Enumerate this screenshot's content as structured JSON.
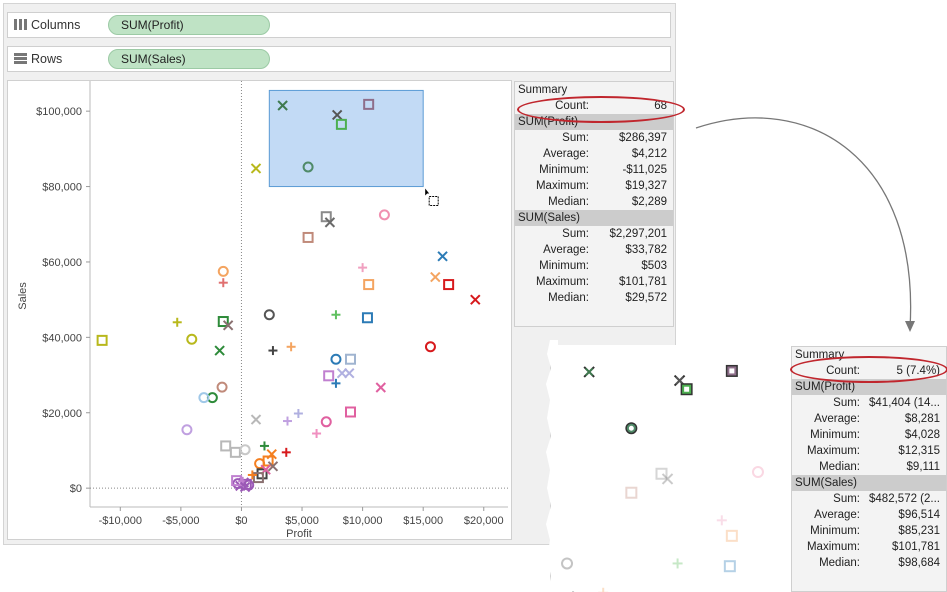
{
  "shelves": {
    "columns": {
      "label": "Columns",
      "pill": "SUM(Profit)"
    },
    "rows": {
      "label": "Rows",
      "pill": "SUM(Sales)"
    }
  },
  "chart_data": {
    "type": "scatter",
    "xlabel": "Profit",
    "ylabel": "Sales",
    "xlim": [
      -12500,
      22000
    ],
    "ylim": [
      -5000,
      108000
    ],
    "x_ticks": [
      -10000,
      -5000,
      0,
      5000,
      10000,
      15000,
      20000
    ],
    "x_tick_labels": [
      "-$10,000",
      "-$5,000",
      "$0",
      "$5,000",
      "$10,000",
      "$15,000",
      "$20,000"
    ],
    "y_ticks": [
      0,
      20000,
      40000,
      60000,
      80000,
      100000
    ],
    "y_tick_labels": [
      "$0",
      "$20,000",
      "$40,000",
      "$60,000",
      "$80,000",
      "$100,000"
    ],
    "grid": false,
    "selection": {
      "x_range": [
        2300,
        15000
      ],
      "y_range": [
        80000,
        105500
      ]
    },
    "points": [
      {
        "x": 3400,
        "y": 101500,
        "shape": "x",
        "color": "#3f7a4f"
      },
      {
        "x": 7900,
        "y": 99000,
        "shape": "x",
        "color": "#555555"
      },
      {
        "x": 8250,
        "y": 96500,
        "shape": "square",
        "color": "#4caf50"
      },
      {
        "x": 10500,
        "y": 101800,
        "shape": "square",
        "color": "#8e6e8a"
      },
      {
        "x": 5500,
        "y": 85200,
        "shape": "circle",
        "color": "#4f8a68"
      },
      {
        "x": 1200,
        "y": 84800,
        "shape": "x",
        "color": "#b8b81c"
      },
      {
        "x": 7000,
        "y": 72000,
        "shape": "square",
        "color": "#8a8a8a"
      },
      {
        "x": 7300,
        "y": 70500,
        "shape": "x",
        "color": "#6b6b6b"
      },
      {
        "x": 11800,
        "y": 72500,
        "shape": "circle",
        "color": "#f090b0"
      },
      {
        "x": 5500,
        "y": 66500,
        "shape": "square",
        "color": "#c08a7a"
      },
      {
        "x": 16600,
        "y": 61500,
        "shape": "x",
        "color": "#2c7bb6"
      },
      {
        "x": 10000,
        "y": 58500,
        "shape": "plus",
        "color": "#f0a0c0"
      },
      {
        "x": 16000,
        "y": 56000,
        "shape": "x",
        "color": "#f4a460"
      },
      {
        "x": 10500,
        "y": 54000,
        "shape": "square",
        "color": "#f4a460"
      },
      {
        "x": 17100,
        "y": 54000,
        "shape": "square",
        "color": "#d7191c"
      },
      {
        "x": 19300,
        "y": 50000,
        "shape": "x",
        "color": "#d7191c"
      },
      {
        "x": -1500,
        "y": 57500,
        "shape": "circle",
        "color": "#f4a460"
      },
      {
        "x": -1500,
        "y": 54500,
        "shape": "plus",
        "color": "#e07070"
      },
      {
        "x": 2300,
        "y": 46000,
        "shape": "circle",
        "color": "#555555"
      },
      {
        "x": 7800,
        "y": 46000,
        "shape": "plus",
        "color": "#60c060"
      },
      {
        "x": 10400,
        "y": 45200,
        "shape": "square",
        "color": "#2c7bb6"
      },
      {
        "x": -1500,
        "y": 44200,
        "shape": "square",
        "color": "#2e8b3a"
      },
      {
        "x": -1100,
        "y": 43200,
        "shape": "x",
        "color": "#8a7070"
      },
      {
        "x": -5300,
        "y": 44000,
        "shape": "plus",
        "color": "#b8b81c"
      },
      {
        "x": -11500,
        "y": 39200,
        "shape": "square",
        "color": "#b8b81c"
      },
      {
        "x": -4100,
        "y": 39500,
        "shape": "circle",
        "color": "#b8b81c"
      },
      {
        "x": -1800,
        "y": 36500,
        "shape": "x",
        "color": "#2e8b3a"
      },
      {
        "x": 2600,
        "y": 36500,
        "shape": "plus",
        "color": "#444444"
      },
      {
        "x": 4100,
        "y": 37500,
        "shape": "plus",
        "color": "#f4a460"
      },
      {
        "x": 15600,
        "y": 37500,
        "shape": "circle",
        "color": "#d7191c"
      },
      {
        "x": 7800,
        "y": 34200,
        "shape": "circle",
        "color": "#2c7bb6"
      },
      {
        "x": 9000,
        "y": 34200,
        "shape": "square",
        "color": "#a0b4d0"
      },
      {
        "x": 7800,
        "y": 27800,
        "shape": "plus",
        "color": "#2c7bb6"
      },
      {
        "x": 7200,
        "y": 29800,
        "shape": "square",
        "color": "#c080d0"
      },
      {
        "x": 8300,
        "y": 30500,
        "shape": "x",
        "color": "#b0b0e0"
      },
      {
        "x": 8900,
        "y": 30500,
        "shape": "x",
        "color": "#b0b0e0"
      },
      {
        "x": 11500,
        "y": 26700,
        "shape": "x",
        "color": "#e060a0"
      },
      {
        "x": -1600,
        "y": 26800,
        "shape": "circle",
        "color": "#c08a7a"
      },
      {
        "x": -2400,
        "y": 24000,
        "shape": "circle",
        "color": "#2e8b3a"
      },
      {
        "x": -3100,
        "y": 24000,
        "shape": "circle",
        "color": "#a0c8e8"
      },
      {
        "x": 4700,
        "y": 19800,
        "shape": "plus",
        "color": "#b0b0e0"
      },
      {
        "x": 3800,
        "y": 17800,
        "shape": "plus",
        "color": "#c0a0e0"
      },
      {
        "x": 9000,
        "y": 20200,
        "shape": "square",
        "color": "#e060a0"
      },
      {
        "x": 7000,
        "y": 17600,
        "shape": "circle",
        "color": "#e060a0"
      },
      {
        "x": 6200,
        "y": 14500,
        "shape": "plus",
        "color": "#f090c0"
      },
      {
        "x": 1200,
        "y": 18200,
        "shape": "x",
        "color": "#b8b8b8"
      },
      {
        "x": -4500,
        "y": 15500,
        "shape": "circle",
        "color": "#c0a0e0"
      },
      {
        "x": -1300,
        "y": 11200,
        "shape": "square",
        "color": "#b8b8b8"
      },
      {
        "x": -500,
        "y": 9500,
        "shape": "square",
        "color": "#b8b8b8"
      },
      {
        "x": 300,
        "y": 10200,
        "shape": "circle",
        "color": "#c8c8c8"
      },
      {
        "x": 1900,
        "y": 11200,
        "shape": "plus",
        "color": "#2e8b3a"
      },
      {
        "x": 3700,
        "y": 9500,
        "shape": "plus",
        "color": "#d7191c"
      },
      {
        "x": 2500,
        "y": 9000,
        "shape": "x",
        "color": "#f47f20"
      },
      {
        "x": 2200,
        "y": 7200,
        "shape": "square",
        "color": "#f47f20"
      },
      {
        "x": 1500,
        "y": 6500,
        "shape": "circle",
        "color": "#f47f20"
      },
      {
        "x": 2600,
        "y": 5800,
        "shape": "x",
        "color": "#8a7070"
      },
      {
        "x": 1700,
        "y": 3800,
        "shape": "square",
        "color": "#444444"
      },
      {
        "x": 2000,
        "y": 4900,
        "shape": "x",
        "color": "#e060a0"
      },
      {
        "x": 1400,
        "y": 2800,
        "shape": "square",
        "color": "#8a7070"
      },
      {
        "x": 900,
        "y": 3500,
        "shape": "plus",
        "color": "#f47f20"
      },
      {
        "x": 200,
        "y": 1500,
        "shape": "x",
        "color": "#9b59b6"
      },
      {
        "x": -300,
        "y": 1200,
        "shape": "circle",
        "color": "#9b59b6"
      },
      {
        "x": 400,
        "y": 1000,
        "shape": "square",
        "color": "#9b59b6"
      },
      {
        "x": -100,
        "y": 600,
        "shape": "x",
        "color": "#9b59b6"
      },
      {
        "x": 100,
        "y": 1800,
        "shape": "plus",
        "color": "#c080d0"
      },
      {
        "x": 600,
        "y": 800,
        "shape": "circle",
        "color": "#9b59b6"
      },
      {
        "x": -400,
        "y": 2000,
        "shape": "square",
        "color": "#c080d0"
      },
      {
        "x": 300,
        "y": 300,
        "shape": "x",
        "color": "#9b59b6"
      }
    ]
  },
  "summary_full": {
    "title": "Summary",
    "count_label": "Count:",
    "count_value": "68",
    "profit_header": "SUM(Profit)",
    "sales_header": "SUM(Sales)",
    "profit": [
      {
        "label": "Sum:",
        "value": "$286,397"
      },
      {
        "label": "Average:",
        "value": "$4,212"
      },
      {
        "label": "Minimum:",
        "value": "-$11,025"
      },
      {
        "label": "Maximum:",
        "value": "$19,327"
      },
      {
        "label": "Median:",
        "value": "$2,289"
      }
    ],
    "sales": [
      {
        "label": "Sum:",
        "value": "$2,297,201"
      },
      {
        "label": "Average:",
        "value": "$33,782"
      },
      {
        "label": "Minimum:",
        "value": "$503"
      },
      {
        "label": "Maximum:",
        "value": "$101,781"
      },
      {
        "label": "Median:",
        "value": "$29,572"
      }
    ]
  },
  "summary_selection": {
    "title": "Summary",
    "count_label": "Count:",
    "count_value": "5 (7.4%)",
    "profit_header": "SUM(Profit)",
    "sales_header": "SUM(Sales)",
    "profit": [
      {
        "label": "Sum:",
        "value": "$41,404 (14..."
      },
      {
        "label": "Average:",
        "value": "$8,281"
      },
      {
        "label": "Minimum:",
        "value": "$4,028"
      },
      {
        "label": "Maximum:",
        "value": "$12,315"
      },
      {
        "label": "Median:",
        "value": "$9,111"
      }
    ],
    "sales": [
      {
        "label": "Sum:",
        "value": "$482,572 (2..."
      },
      {
        "label": "Average:",
        "value": "$96,514"
      },
      {
        "label": "Minimum:",
        "value": "$85,231"
      },
      {
        "label": "Maximum:",
        "value": "$101,781"
      },
      {
        "label": "Median:",
        "value": "$98,684"
      }
    ]
  },
  "colors": {
    "pill_bg": "#bfe3c5",
    "selection_fill": "#b7d4f3",
    "selection_stroke": "#5b9bd5",
    "highlight_ellipse": "#c0262d"
  }
}
